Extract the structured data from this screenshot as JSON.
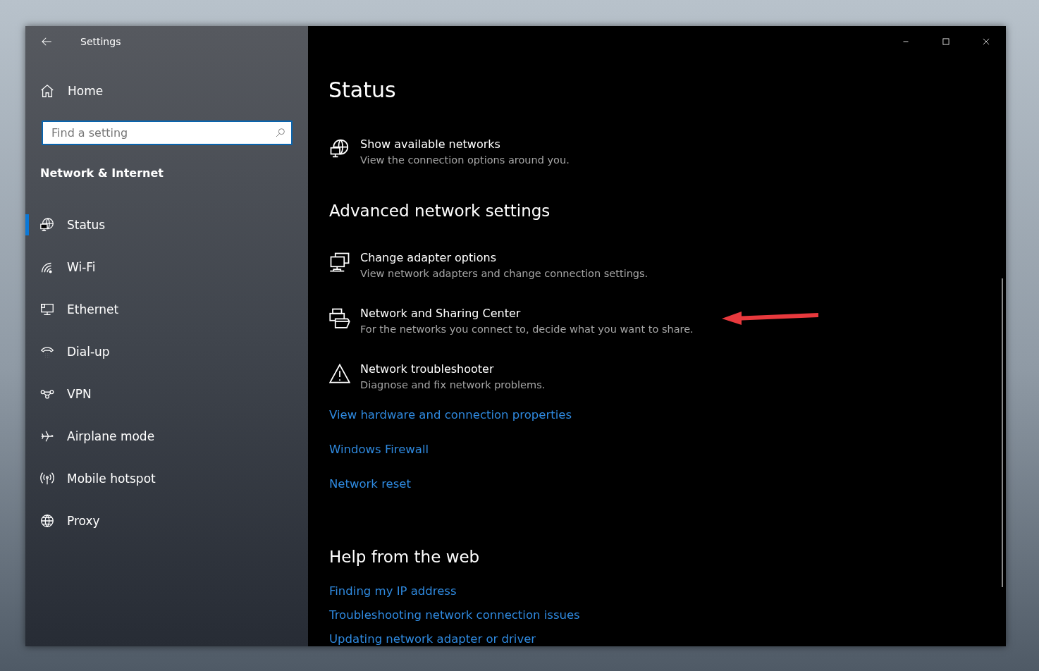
{
  "window": {
    "title": "Settings"
  },
  "sidebar": {
    "home": "Home",
    "search": {
      "placeholder": "Find a setting"
    },
    "section": "Network & Internet",
    "items": [
      {
        "label": "Status",
        "kind": "status",
        "selected": true
      },
      {
        "label": "Wi-Fi",
        "kind": "wifi",
        "selected": false
      },
      {
        "label": "Ethernet",
        "kind": "ethernet",
        "selected": false
      },
      {
        "label": "Dial-up",
        "kind": "dialup",
        "selected": false
      },
      {
        "label": "VPN",
        "kind": "vpn",
        "selected": false
      },
      {
        "label": "Airplane mode",
        "kind": "airplane",
        "selected": false
      },
      {
        "label": "Mobile hotspot",
        "kind": "hotspot",
        "selected": false
      },
      {
        "label": "Proxy",
        "kind": "proxy",
        "selected": false
      }
    ]
  },
  "main": {
    "title": "Status",
    "top_items": [
      {
        "kind": "networks",
        "title": "Show available networks",
        "description": "View the connection options around you."
      }
    ],
    "advanced": {
      "heading": "Advanced network settings",
      "items": [
        {
          "kind": "adapter",
          "title": "Change adapter options",
          "description": "View network adapters and change connection settings."
        },
        {
          "kind": "sharing",
          "title": "Network and Sharing Center",
          "description": "For the networks you connect to, decide what you want to share."
        },
        {
          "kind": "troubleshoot",
          "title": "Network troubleshooter",
          "description": "Diagnose and fix network problems."
        }
      ],
      "links": [
        "View hardware and connection properties",
        "Windows Firewall",
        "Network reset"
      ]
    },
    "help": {
      "heading": "Help from the web",
      "links": [
        "Finding my IP address",
        "Troubleshooting network connection issues",
        "Updating network adapter or driver"
      ]
    }
  }
}
